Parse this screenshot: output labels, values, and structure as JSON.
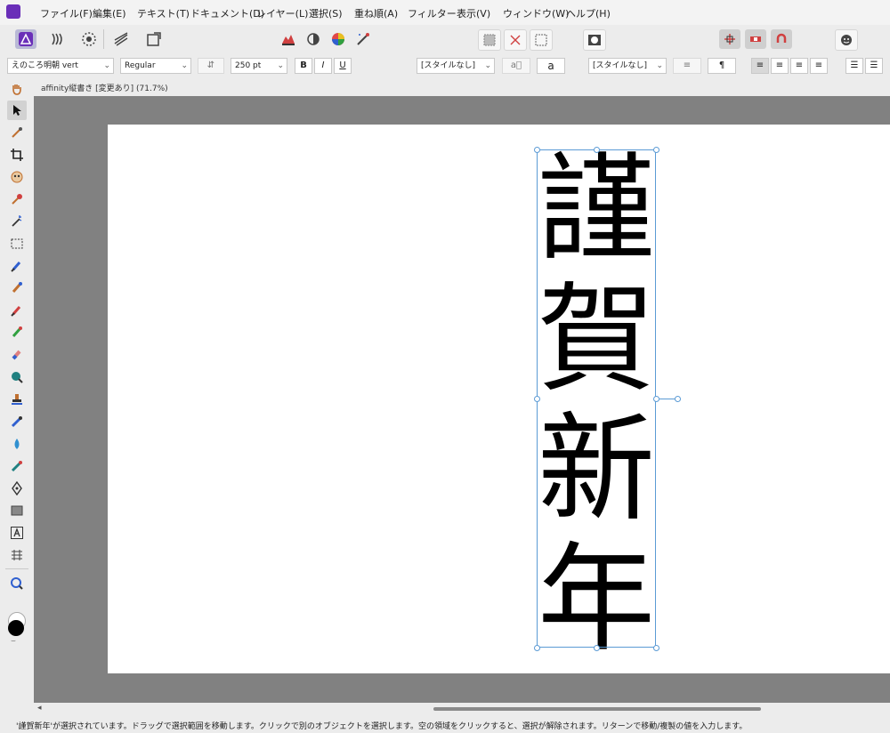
{
  "menu": [
    "ファイル(F)",
    "編集(E)",
    "テキスト(T)",
    "ドキュメント(D)",
    "レイヤー(L)",
    "選択(S)",
    "重ね順(A)",
    "フィルター",
    "表示(V)",
    "ウィンドウ(W)",
    "ヘルプ(H)"
  ],
  "context": {
    "font_family": "えのころ明朝 vert",
    "font_style": "Regular",
    "font_size": "250 pt",
    "bold": "B",
    "italic": "I",
    "underline": "U",
    "text_color": "#000000",
    "char_style_icon": "a",
    "char_style": "[スタイルなし]",
    "a_button": "a",
    "pilcrow": "¶",
    "para_style": "[スタイルなし]",
    "pilcrow_button": "¶"
  },
  "document": {
    "tab_title": "affinity縦書き [変更あり] (71.7%)",
    "text_chars": [
      "謹",
      "賀",
      "新",
      "年"
    ]
  },
  "status": "'謹賀新年'が選択されています。ドラッグで選択範囲を移動します。クリックで別のオブジェクトを選択します。空の領域をクリックすると、選択が解除されます。リターンで移動/複製の値を入力します。",
  "colors": {
    "accent": "#6a2fb8",
    "selection": "#5b9bd5",
    "canvas": "#818181"
  }
}
